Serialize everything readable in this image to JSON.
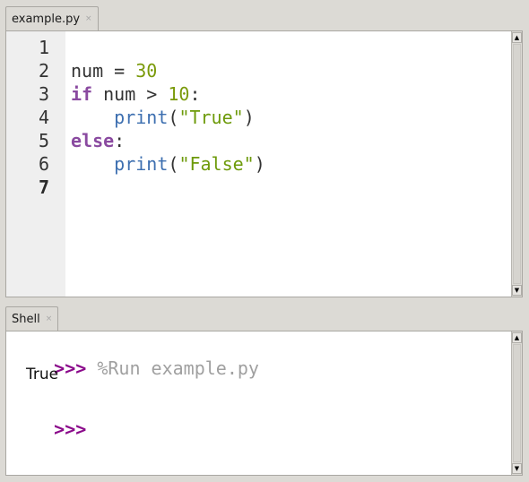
{
  "editor": {
    "tab": {
      "label": "example.py",
      "close": "×"
    },
    "line_numbers": [
      "1",
      "2",
      "3",
      "4",
      "5",
      "6",
      "7"
    ],
    "current_line": "7",
    "lines": [
      [],
      [
        {
          "t": "plain",
          "v": "num = "
        },
        {
          "t": "num",
          "v": "30"
        }
      ],
      [
        {
          "t": "kw",
          "v": "if"
        },
        {
          "t": "plain",
          "v": " num > "
        },
        {
          "t": "num",
          "v": "10"
        },
        {
          "t": "plain",
          "v": ":"
        }
      ],
      [
        {
          "t": "plain",
          "v": "    "
        },
        {
          "t": "fn",
          "v": "print"
        },
        {
          "t": "plain",
          "v": "("
        },
        {
          "t": "str",
          "v": "\"True\""
        },
        {
          "t": "plain",
          "v": ")"
        }
      ],
      [
        {
          "t": "kw",
          "v": "else"
        },
        {
          "t": "plain",
          "v": ":"
        }
      ],
      [
        {
          "t": "plain",
          "v": "    "
        },
        {
          "t": "fn",
          "v": "print"
        },
        {
          "t": "plain",
          "v": "("
        },
        {
          "t": "str",
          "v": "\"False\""
        },
        {
          "t": "plain",
          "v": ")"
        }
      ],
      []
    ]
  },
  "shell": {
    "tab": {
      "label": "Shell",
      "close": "×"
    },
    "prompt": ">>>",
    "command": "%Run example.py",
    "output": "True",
    "prompt2": ">>>"
  },
  "scrollbar": {
    "up": "▲",
    "down": "▼"
  }
}
